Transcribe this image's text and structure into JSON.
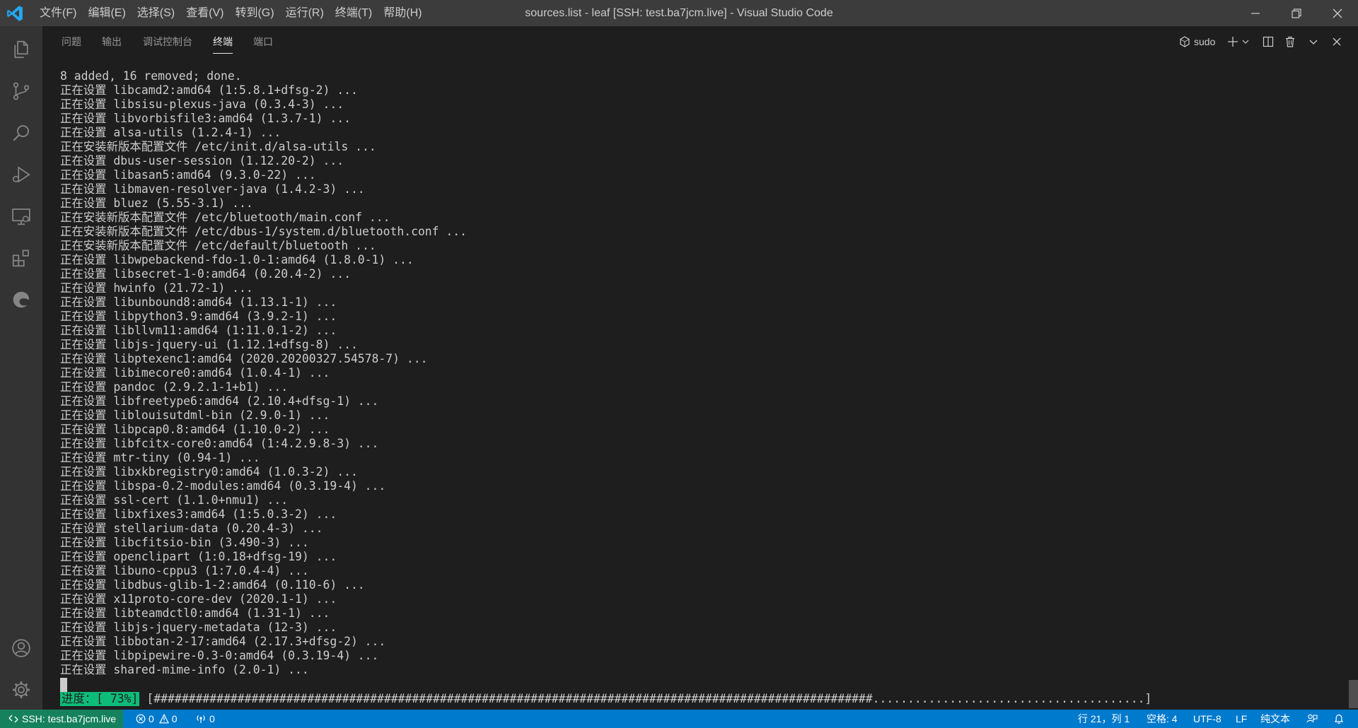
{
  "titlebar": {
    "menu": [
      "文件(F)",
      "编辑(E)",
      "选择(S)",
      "查看(V)",
      "转到(G)",
      "运行(R)",
      "终端(T)",
      "帮助(H)"
    ],
    "title": "sources.list - leaf [SSH: test.ba7jcm.live] - Visual Studio Code"
  },
  "activitybar": {
    "icons": [
      "explorer-icon",
      "source-control-icon",
      "search-icon",
      "run-debug-icon",
      "remote-explorer-icon",
      "extensions-icon",
      "edge-icon",
      "account-icon",
      "settings-gear-icon"
    ]
  },
  "panel": {
    "tabs": [
      "问题",
      "输出",
      "调试控制台",
      "终端",
      "端口"
    ],
    "active_tab": "终端",
    "terminal_name": "sudo"
  },
  "terminal": {
    "lines": [
      "8 added, 16 removed; done.",
      "正在设置 libcamd2:amd64 (1:5.8.1+dfsg-2) ...",
      "正在设置 libsisu-plexus-java (0.3.4-3) ...",
      "正在设置 libvorbisfile3:amd64 (1.3.7-1) ...",
      "正在设置 alsa-utils (1.2.4-1) ...",
      "正在安装新版本配置文件 /etc/init.d/alsa-utils ...",
      "正在设置 dbus-user-session (1.12.20-2) ...",
      "正在设置 libasan5:amd64 (9.3.0-22) ...",
      "正在设置 libmaven-resolver-java (1.4.2-3) ...",
      "正在设置 bluez (5.55-3.1) ...",
      "正在安装新版本配置文件 /etc/bluetooth/main.conf ...",
      "正在安装新版本配置文件 /etc/dbus-1/system.d/bluetooth.conf ...",
      "正在安装新版本配置文件 /etc/default/bluetooth ...",
      "正在设置 libwpebackend-fdo-1.0-1:amd64 (1.8.0-1) ...",
      "正在设置 libsecret-1-0:amd64 (0.20.4-2) ...",
      "正在设置 hwinfo (21.72-1) ...",
      "正在设置 libunbound8:amd64 (1.13.1-1) ...",
      "正在设置 libpython3.9:amd64 (3.9.2-1) ...",
      "正在设置 libllvm11:amd64 (1:11.0.1-2) ...",
      "正在设置 libjs-jquery-ui (1.12.1+dfsg-8) ...",
      "正在设置 libptexenc1:amd64 (2020.20200327.54578-7) ...",
      "正在设置 libimecore0:amd64 (1.0.4-1) ...",
      "正在设置 pandoc (2.9.2.1-1+b1) ...",
      "正在设置 libfreetype6:amd64 (2.10.4+dfsg-1) ...",
      "正在设置 liblouisutdml-bin (2.9.0-1) ...",
      "正在设置 libpcap0.8:amd64 (1.10.0-2) ...",
      "正在设置 libfcitx-core0:amd64 (1:4.2.9.8-3) ...",
      "正在设置 mtr-tiny (0.94-1) ...",
      "正在设置 libxkbregistry0:amd64 (1.0.3-2) ...",
      "正在设置 libspa-0.2-modules:amd64 (0.3.19-4) ...",
      "正在设置 ssl-cert (1.1.0+nmu1) ...",
      "正在设置 libxfixes3:amd64 (1:5.0.3-2) ...",
      "正在设置 stellarium-data (0.20.4-3) ...",
      "正在设置 libcfitsio-bin (3.490-3) ...",
      "正在设置 openclipart (1:0.18+dfsg-19) ...",
      "正在设置 libuno-cppu3 (1:7.0.4-4) ...",
      "正在设置 libdbus-glib-1-2:amd64 (0.110-6) ...",
      "正在设置 x11proto-core-dev (2020.1-1) ...",
      "正在设置 libteamdctl0:amd64 (1.31-1) ...",
      "正在设置 libjs-jquery-metadata (12-3) ...",
      "正在设置 libbotan-2-17:amd64 (2.17.3+dfsg-2) ...",
      "正在设置 libpipewire-0.3-0:amd64 (0.3.19-4) ...",
      "正在设置 shared-mime-info (2.0-1) ..."
    ],
    "progress_label": "进度：[ 73%]",
    "progress_bar": "[#######################################################################################################.......................................]"
  },
  "statusbar": {
    "remote": "SSH: test.ba7jcm.live",
    "errors": "0",
    "warnings": "0",
    "ports": "0",
    "position": "行 21，列 1",
    "spaces": "空格: 4",
    "encoding": "UTF-8",
    "eol": "LF",
    "language": "纯文本"
  },
  "colors": {
    "titlebar": "#3c3c3c",
    "activitybar": "#333333",
    "editor_bg": "#1e1e1e",
    "statusbar": "#007acc",
    "remote": "#16825d",
    "progress": "#0dbc79"
  }
}
